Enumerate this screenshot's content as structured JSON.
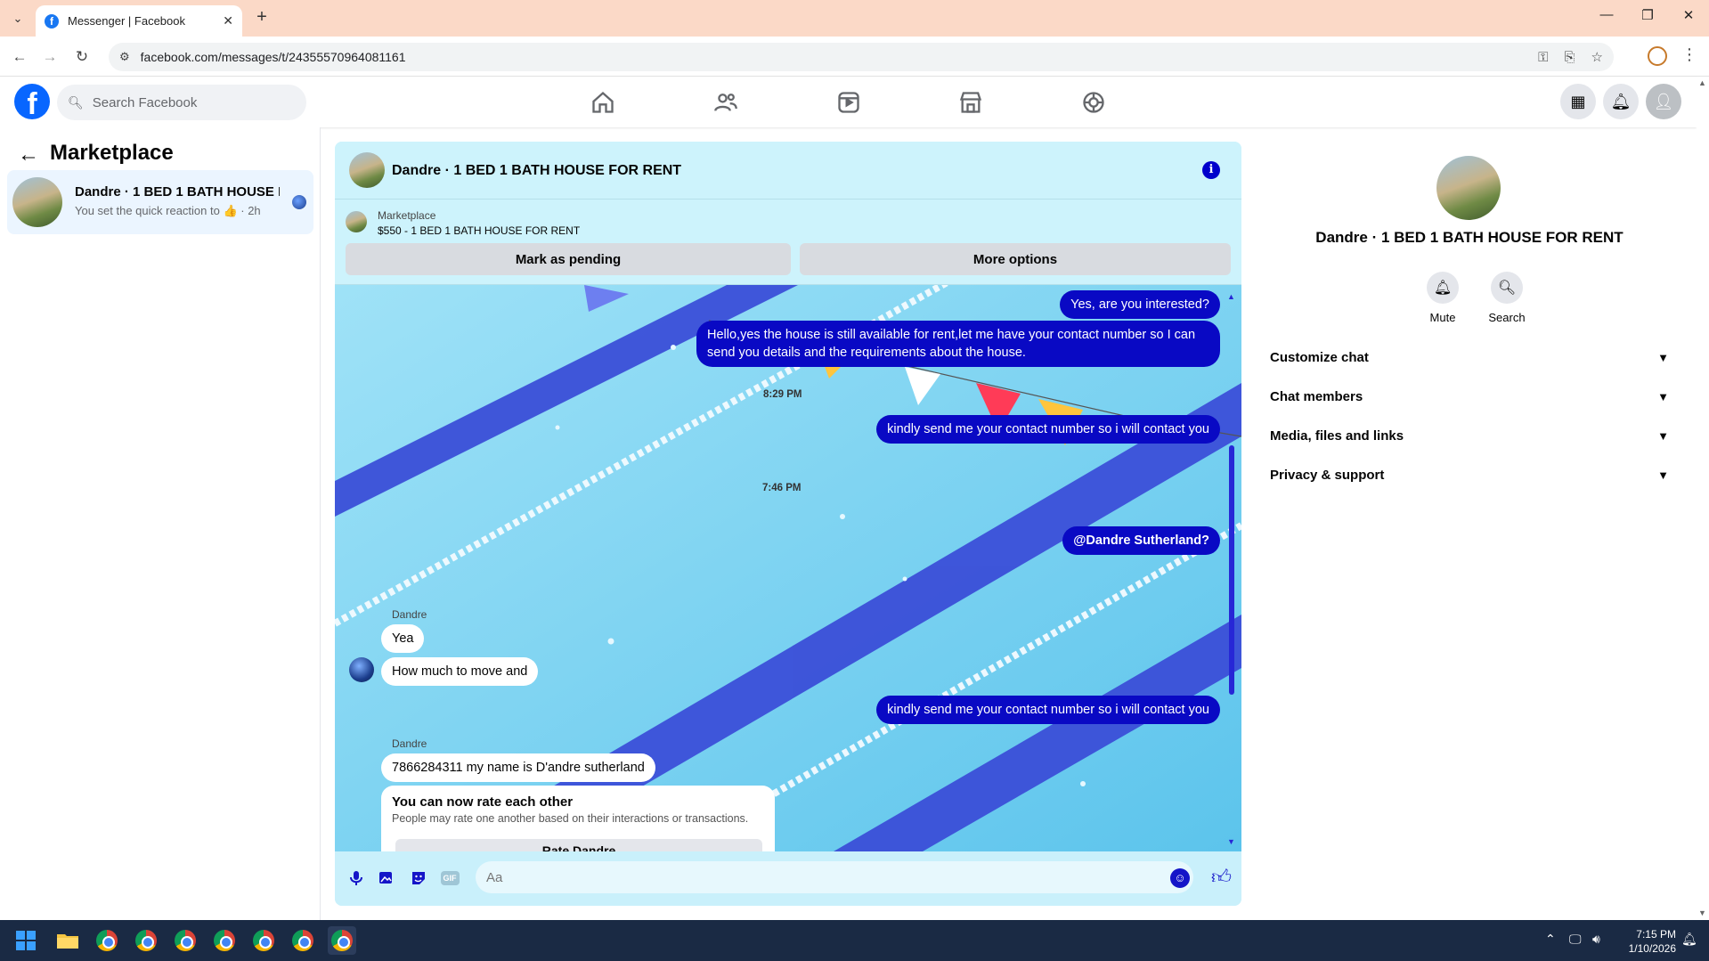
{
  "browser": {
    "tab_title": "Messenger | Facebook",
    "tab_close": "✕",
    "new_tab": "+",
    "url": "facebook.com/messages/t/24355570964081161",
    "window_controls": [
      "—",
      "❐",
      "✕"
    ]
  },
  "fb_header": {
    "logo_letter": "f",
    "search_placeholder": "Search Facebook"
  },
  "sidebar": {
    "title": "Marketplace",
    "conversation": {
      "name": "Dandre · 1 BED 1 BATH HOUSE F...",
      "snippet": "You set the quick reaction to 👍 · 2h"
    }
  },
  "chat": {
    "title": "Dandre · 1 BED 1 BATH HOUSE FOR RENT",
    "info_glyph": "i",
    "listing": {
      "category": "Marketplace",
      "price_title": "$550 - 1 BED 1 BATH HOUSE FOR RENT",
      "mark_pending_label": "Mark as pending",
      "more_options_label": "More options"
    },
    "messages": {
      "out_1": "Yes, are you interested?",
      "out_2": "Hello,yes the house is still available for rent,let me have your contact number   so I can send you details and the requirements about the house.",
      "ts_1": "8:29 PM",
      "out_3": "kindly send me your contact number so i will contact you",
      "ts_2": "7:46 PM",
      "out_4": "@Dandre Sutherland?",
      "sender_1": "Dandre",
      "in_1": "Yea",
      "in_2": "How much to move and",
      "out_5": "kindly send me your contact number so i will contact you",
      "sender_2": "Dandre",
      "in_3": "7866284311 my name is D'andre sutherland"
    },
    "rate_card": {
      "title": "You can now rate each other",
      "description": "People may rate one another based on their interactions or transactions.",
      "button": "Rate Dandre"
    },
    "composer": {
      "placeholder": "Aa",
      "gif_label": "GIF"
    }
  },
  "right_panel": {
    "name": "Dandre · 1 BED 1 BATH HOUSE FOR RENT",
    "actions": [
      {
        "label": "Mute",
        "icon": "bell-icon"
      },
      {
        "label": "Search",
        "icon": "search-icon"
      }
    ],
    "sections": [
      "Customize chat",
      "Chat members",
      "Media, files and links",
      "Privacy & support"
    ]
  },
  "taskbar": {
    "time": "7:15 PM",
    "date": "1/10/2026"
  },
  "colors": {
    "fb_blue": "#0866ff",
    "bubble_out": "#0909c4",
    "chat_bg": "#7ed3f2"
  }
}
